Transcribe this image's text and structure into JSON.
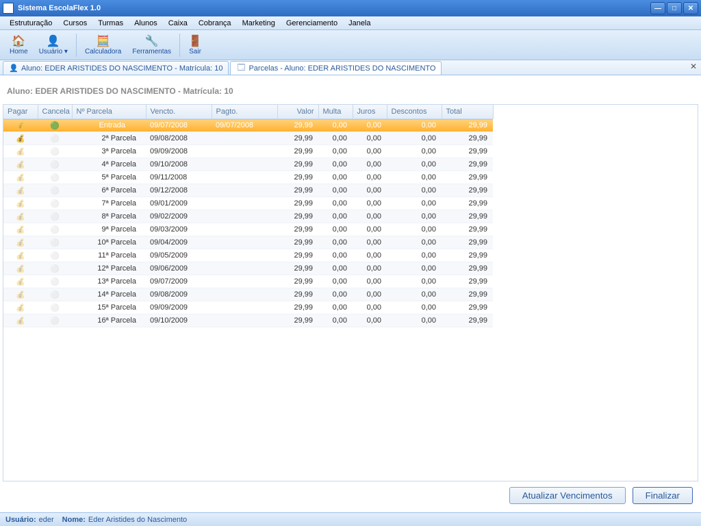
{
  "window": {
    "title": "Sistema EscolaFlex 1.0"
  },
  "menu": [
    "Estruturação",
    "Cursos",
    "Turmas",
    "Alunos",
    "Caixa",
    "Cobrança",
    "Marketing",
    "Gerenciamento",
    "Janela"
  ],
  "toolbar": {
    "home": "Home",
    "usuario": "Usuário",
    "calculadora": "Calculadora",
    "ferramentas": "Ferramentas",
    "sair": "Sair"
  },
  "tabs": {
    "tab1": "Aluno: EDER ARISTIDES DO NASCIMENTO - Matrícula: 10",
    "tab2": "Parcelas - Aluno: EDER ARISTIDES DO NASCIMENTO"
  },
  "page": {
    "title": "Aluno: EDER ARISTIDES DO NASCIMENTO - Matrícula: 10"
  },
  "columns": {
    "pagar": "Pagar",
    "cancela": "Cancela",
    "parcela": "Nº Parcela",
    "vencto": "Vencto.",
    "pagto": "Pagto.",
    "valor": "Valor",
    "multa": "Multa",
    "juros": "Juros",
    "descontos": "Descontos",
    "total": "Total"
  },
  "rows": [
    {
      "parcela": "Entrada",
      "vencto": "09/07/2008",
      "pagto": "09/07/2008",
      "valor": "29,99",
      "multa": "0,00",
      "juros": "0,00",
      "descontos": "0,00",
      "total": "29,99",
      "selected": true,
      "pay_enabled": false,
      "cancel_enabled": true
    },
    {
      "parcela": "2ª Parcela",
      "vencto": "09/08/2008",
      "pagto": "",
      "valor": "29,99",
      "multa": "0,00",
      "juros": "0,00",
      "descontos": "0,00",
      "total": "29,99",
      "pay_enabled": true,
      "cancel_enabled": false
    },
    {
      "parcela": "3ª Parcela",
      "vencto": "09/09/2008",
      "pagto": "",
      "valor": "29,99",
      "multa": "0,00",
      "juros": "0,00",
      "descontos": "0,00",
      "total": "29,99",
      "pay_enabled": false,
      "cancel_enabled": false
    },
    {
      "parcela": "4ª Parcela",
      "vencto": "09/10/2008",
      "pagto": "",
      "valor": "29,99",
      "multa": "0,00",
      "juros": "0,00",
      "descontos": "0,00",
      "total": "29,99",
      "pay_enabled": false,
      "cancel_enabled": false
    },
    {
      "parcela": "5ª Parcela",
      "vencto": "09/11/2008",
      "pagto": "",
      "valor": "29,99",
      "multa": "0,00",
      "juros": "0,00",
      "descontos": "0,00",
      "total": "29,99",
      "pay_enabled": false,
      "cancel_enabled": false
    },
    {
      "parcela": "6ª Parcela",
      "vencto": "09/12/2008",
      "pagto": "",
      "valor": "29,99",
      "multa": "0,00",
      "juros": "0,00",
      "descontos": "0,00",
      "total": "29,99",
      "pay_enabled": false,
      "cancel_enabled": false
    },
    {
      "parcela": "7ª Parcela",
      "vencto": "09/01/2009",
      "pagto": "",
      "valor": "29,99",
      "multa": "0,00",
      "juros": "0,00",
      "descontos": "0,00",
      "total": "29,99",
      "pay_enabled": false,
      "cancel_enabled": false
    },
    {
      "parcela": "8ª Parcela",
      "vencto": "09/02/2009",
      "pagto": "",
      "valor": "29,99",
      "multa": "0,00",
      "juros": "0,00",
      "descontos": "0,00",
      "total": "29,99",
      "pay_enabled": false,
      "cancel_enabled": false
    },
    {
      "parcela": "9ª Parcela",
      "vencto": "09/03/2009",
      "pagto": "",
      "valor": "29,99",
      "multa": "0,00",
      "juros": "0,00",
      "descontos": "0,00",
      "total": "29,99",
      "pay_enabled": false,
      "cancel_enabled": false
    },
    {
      "parcela": "10ª Parcela",
      "vencto": "09/04/2009",
      "pagto": "",
      "valor": "29,99",
      "multa": "0,00",
      "juros": "0,00",
      "descontos": "0,00",
      "total": "29,99",
      "pay_enabled": false,
      "cancel_enabled": false
    },
    {
      "parcela": "11ª Parcela",
      "vencto": "09/05/2009",
      "pagto": "",
      "valor": "29,99",
      "multa": "0,00",
      "juros": "0,00",
      "descontos": "0,00",
      "total": "29,99",
      "pay_enabled": false,
      "cancel_enabled": false
    },
    {
      "parcela": "12ª Parcela",
      "vencto": "09/06/2009",
      "pagto": "",
      "valor": "29,99",
      "multa": "0,00",
      "juros": "0,00",
      "descontos": "0,00",
      "total": "29,99",
      "pay_enabled": false,
      "cancel_enabled": false
    },
    {
      "parcela": "13ª Parcela",
      "vencto": "09/07/2009",
      "pagto": "",
      "valor": "29,99",
      "multa": "0,00",
      "juros": "0,00",
      "descontos": "0,00",
      "total": "29,99",
      "pay_enabled": false,
      "cancel_enabled": false
    },
    {
      "parcela": "14ª Parcela",
      "vencto": "09/08/2009",
      "pagto": "",
      "valor": "29,99",
      "multa": "0,00",
      "juros": "0,00",
      "descontos": "0,00",
      "total": "29,99",
      "pay_enabled": false,
      "cancel_enabled": false
    },
    {
      "parcela": "15ª Parcela",
      "vencto": "09/09/2009",
      "pagto": "",
      "valor": "29,99",
      "multa": "0,00",
      "juros": "0,00",
      "descontos": "0,00",
      "total": "29,99",
      "pay_enabled": false,
      "cancel_enabled": false
    },
    {
      "parcela": "16ª Parcela",
      "vencto": "09/10/2009",
      "pagto": "",
      "valor": "29,99",
      "multa": "0,00",
      "juros": "0,00",
      "descontos": "0,00",
      "total": "29,99",
      "pay_enabled": false,
      "cancel_enabled": false
    }
  ],
  "buttons": {
    "atualizar": "Atualizar Vencimentos",
    "finalizar": "Finalizar"
  },
  "status": {
    "usuario_label": "Usuário:",
    "usuario": "eder",
    "nome_label": "Nome:",
    "nome": "Eder Aristides do Nascimento"
  }
}
